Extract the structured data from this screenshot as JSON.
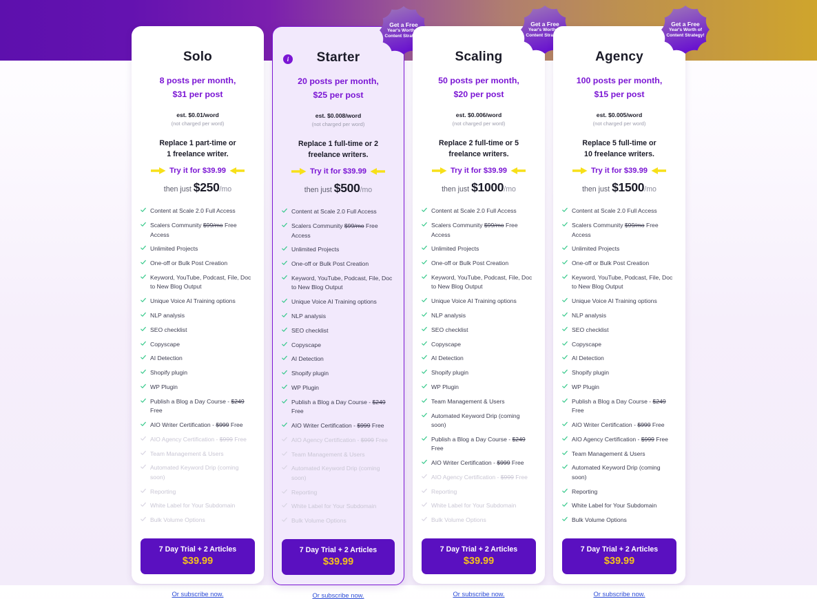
{
  "page": {
    "background_top_left": "#5d10ad",
    "background_top_right": "#cfa52c",
    "background_body": "#f3ecfa"
  },
  "badge": {
    "line1": "Get a Free",
    "line2": "Year's Worth of",
    "line3": "Content Strategy!",
    "color_from": "#a07ab8",
    "color_to": "#6a14cf"
  },
  "common": {
    "est_sub": "(not charged per word)",
    "try_label": "Try it for $39.99",
    "then_prefix": "then just",
    "per_mo": "/mo",
    "cta_line1": "7 Day Trial + 2 Articles",
    "cta_line2": "$39.99",
    "subscribe_link": "Or subscribe now.",
    "accent": "#7b16d4",
    "cta_bg": "#5a10c0",
    "cta_price_color": "#f5c11a",
    "arrow_color": "#f7e019",
    "tick_on": "#35c98a",
    "tick_off": "#d8d4e2",
    "info_icon": "info-icon"
  },
  "plans": [
    {
      "name": "Solo",
      "has_info_icon": false,
      "has_badge": false,
      "highlight": false,
      "posts_line1": "8 posts per month,",
      "posts_line2": "$31 per post",
      "est": "est. $0.01/word",
      "replace_line1": "Replace 1 part-time or",
      "replace_line2": "1 freelance writer.",
      "then_price": "$250",
      "features": [
        {
          "text": "Content at Scale 2.0 Full Access",
          "included": true
        },
        {
          "text": "Scalers Community $99/mo Free Access",
          "included": true,
          "strike": "$99/mo"
        },
        {
          "text": "Unlimited Projects",
          "included": true
        },
        {
          "text": "One-off or Bulk Post Creation",
          "included": true
        },
        {
          "text": "Keyword, YouTube, Podcast, File, Doc to New Blog Output",
          "included": true
        },
        {
          "text": "Unique Voice AI Training options",
          "included": true
        },
        {
          "text": "NLP analysis",
          "included": true
        },
        {
          "text": "SEO checklist",
          "included": true
        },
        {
          "text": "Copyscape",
          "included": true
        },
        {
          "text": "AI Detection",
          "included": true
        },
        {
          "text": "Shopify plugin",
          "included": true
        },
        {
          "text": "WP Plugin",
          "included": true
        },
        {
          "text": "Publish a Blog a Day Course - $249 Free",
          "included": true,
          "strike": "$249"
        },
        {
          "text": "AIO Writer Certification - $999 Free",
          "included": true,
          "strike": "$999"
        },
        {
          "text": "AIO Agency Certification - $999 Free",
          "included": false,
          "strike": "$999"
        },
        {
          "text": "Team Management & Users",
          "included": false
        },
        {
          "text": "Automated Keyword Drip (coming soon)",
          "included": false
        },
        {
          "text": "Reporting",
          "included": false
        },
        {
          "text": "White Label for Your Subdomain",
          "included": false
        },
        {
          "text": "Bulk Volume Options",
          "included": false
        }
      ]
    },
    {
      "name": "Starter",
      "has_info_icon": true,
      "has_badge": true,
      "highlight": true,
      "posts_line1": "20 posts per month,",
      "posts_line2": "$25 per post",
      "est": "est. $0.008/word",
      "replace_line1": "Replace 1 full-time or 2",
      "replace_line2": "freelance writers.",
      "then_price": "$500",
      "features": [
        {
          "text": "Content at Scale 2.0 Full Access",
          "included": true
        },
        {
          "text": "Scalers Community $99/mo Free Access",
          "included": true,
          "strike": "$99/mo"
        },
        {
          "text": "Unlimited Projects",
          "included": true
        },
        {
          "text": "One-off or Bulk Post Creation",
          "included": true
        },
        {
          "text": "Keyword, YouTube, Podcast, File, Doc to New Blog Output",
          "included": true
        },
        {
          "text": "Unique Voice AI Training options",
          "included": true
        },
        {
          "text": "NLP analysis",
          "included": true
        },
        {
          "text": "SEO checklist",
          "included": true
        },
        {
          "text": "Copyscape",
          "included": true
        },
        {
          "text": "AI Detection",
          "included": true
        },
        {
          "text": "Shopify plugin",
          "included": true
        },
        {
          "text": "WP Plugin",
          "included": true
        },
        {
          "text": "Publish a Blog a Day Course - $249 Free",
          "included": true,
          "strike": "$249"
        },
        {
          "text": "AIO Writer Certification - $999 Free",
          "included": true,
          "strike": "$999"
        },
        {
          "text": "AIO Agency Certification - $999 Free",
          "included": false,
          "strike": "$999"
        },
        {
          "text": "Team Management & Users",
          "included": false
        },
        {
          "text": "Automated Keyword Drip (coming soon)",
          "included": false
        },
        {
          "text": "Reporting",
          "included": false
        },
        {
          "text": "White Label for Your Subdomain",
          "included": false
        },
        {
          "text": "Bulk Volume Options",
          "included": false
        }
      ]
    },
    {
      "name": "Scaling",
      "has_info_icon": false,
      "has_badge": true,
      "highlight": false,
      "posts_line1": "50 posts per month,",
      "posts_line2": "$20 per post",
      "est": "est. $0.006/word",
      "replace_line1": "Replace 2 full-time or 5",
      "replace_line2": "freelance writers.",
      "then_price": "$1000",
      "features": [
        {
          "text": "Content at Scale 2.0 Full Access",
          "included": true
        },
        {
          "text": "Scalers Community $99/mo Free Access",
          "included": true,
          "strike": "$99/mo"
        },
        {
          "text": "Unlimited Projects",
          "included": true
        },
        {
          "text": "One-off or Bulk Post Creation",
          "included": true
        },
        {
          "text": "Keyword, YouTube, Podcast, File, Doc to New Blog Output",
          "included": true
        },
        {
          "text": "Unique Voice AI Training options",
          "included": true
        },
        {
          "text": "NLP analysis",
          "included": true
        },
        {
          "text": "SEO checklist",
          "included": true
        },
        {
          "text": "Copyscape",
          "included": true
        },
        {
          "text": "AI Detection",
          "included": true
        },
        {
          "text": "Shopify plugin",
          "included": true
        },
        {
          "text": "WP Plugin",
          "included": true
        },
        {
          "text": "Team Management & Users",
          "included": true
        },
        {
          "text": "Automated Keyword Drip (coming soon)",
          "included": true
        },
        {
          "text": "Publish a Blog a Day Course - $249 Free",
          "included": true,
          "strike": "$249"
        },
        {
          "text": "AIO Writer Certification - $999 Free",
          "included": true,
          "strike": "$999"
        },
        {
          "text": "AIO Agency Certification - $999 Free",
          "included": false,
          "strike": "$999"
        },
        {
          "text": "Reporting",
          "included": false
        },
        {
          "text": "White Label for Your Subdomain",
          "included": false
        },
        {
          "text": "Bulk Volume Options",
          "included": false
        }
      ]
    },
    {
      "name": "Agency",
      "has_info_icon": false,
      "has_badge": true,
      "highlight": false,
      "posts_line1": "100 posts per month,",
      "posts_line2": "$15 per post",
      "est": "est. $0.005/word",
      "replace_line1": "Replace 5 full-time or",
      "replace_line2": "10 freelance writers.",
      "then_price": "$1500",
      "features": [
        {
          "text": "Content at Scale 2.0 Full Access",
          "included": true
        },
        {
          "text": "Scalers Community $99/mo Free Access",
          "included": true,
          "strike": "$99/mo"
        },
        {
          "text": "Unlimited Projects",
          "included": true
        },
        {
          "text": "One-off or Bulk Post Creation",
          "included": true
        },
        {
          "text": "Keyword, YouTube, Podcast, File, Doc to New Blog Output",
          "included": true
        },
        {
          "text": "Unique Voice AI Training options",
          "included": true
        },
        {
          "text": "NLP analysis",
          "included": true
        },
        {
          "text": "SEO checklist",
          "included": true
        },
        {
          "text": "Copyscape",
          "included": true
        },
        {
          "text": "AI Detection",
          "included": true
        },
        {
          "text": "Shopify plugin",
          "included": true
        },
        {
          "text": "WP Plugin",
          "included": true
        },
        {
          "text": "Publish a Blog a Day Course - $249 Free",
          "included": true,
          "strike": "$249"
        },
        {
          "text": "AIO Writer Certification - $999 Free",
          "included": true,
          "strike": "$999"
        },
        {
          "text": "AIO Agency Certification - $999 Free",
          "included": true,
          "strike": "$999"
        },
        {
          "text": "Team Management & Users",
          "included": true
        },
        {
          "text": "Automated Keyword Drip (coming soon)",
          "included": true
        },
        {
          "text": "Reporting",
          "included": true
        },
        {
          "text": "White Label for Your Subdomain",
          "included": true
        },
        {
          "text": "Bulk Volume Options",
          "included": true
        }
      ]
    }
  ]
}
